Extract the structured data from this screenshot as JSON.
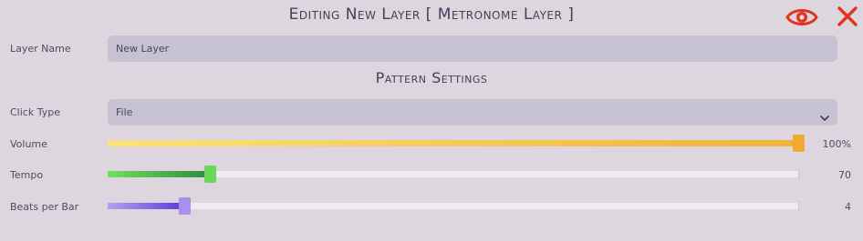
{
  "header": {
    "title": "Editing New Layer [ Metronome Layer ]",
    "visibility_icon": "eye-icon",
    "close_icon": "close-icon"
  },
  "layer_name": {
    "label": "Layer Name",
    "value": "New Layer"
  },
  "section_title": "Pattern Settings",
  "click_type": {
    "label": "Click Type",
    "selected": "File",
    "icon": "chevron-down-icon"
  },
  "volume": {
    "label": "Volume",
    "value_text": "100%",
    "level": 1.0,
    "color_start": "#f9e37a",
    "color_end": "#f1b23a",
    "handle_color": "#f0aa30"
  },
  "tempo": {
    "label": "Tempo",
    "value_text": "70",
    "color_start": "#6fe060",
    "color_end": "#2f8a3e",
    "handle_color": "#6cd65a"
  },
  "beats_per_bar": {
    "label": "Beats per Bar",
    "value_text": "4",
    "color_start": "#b79ff0",
    "color_end": "#5b3dd3",
    "handle_color": "#a990ea"
  },
  "colors": {
    "accent_red": "#e0341f",
    "background": "#ded6de",
    "field": "#c7c2d2"
  }
}
